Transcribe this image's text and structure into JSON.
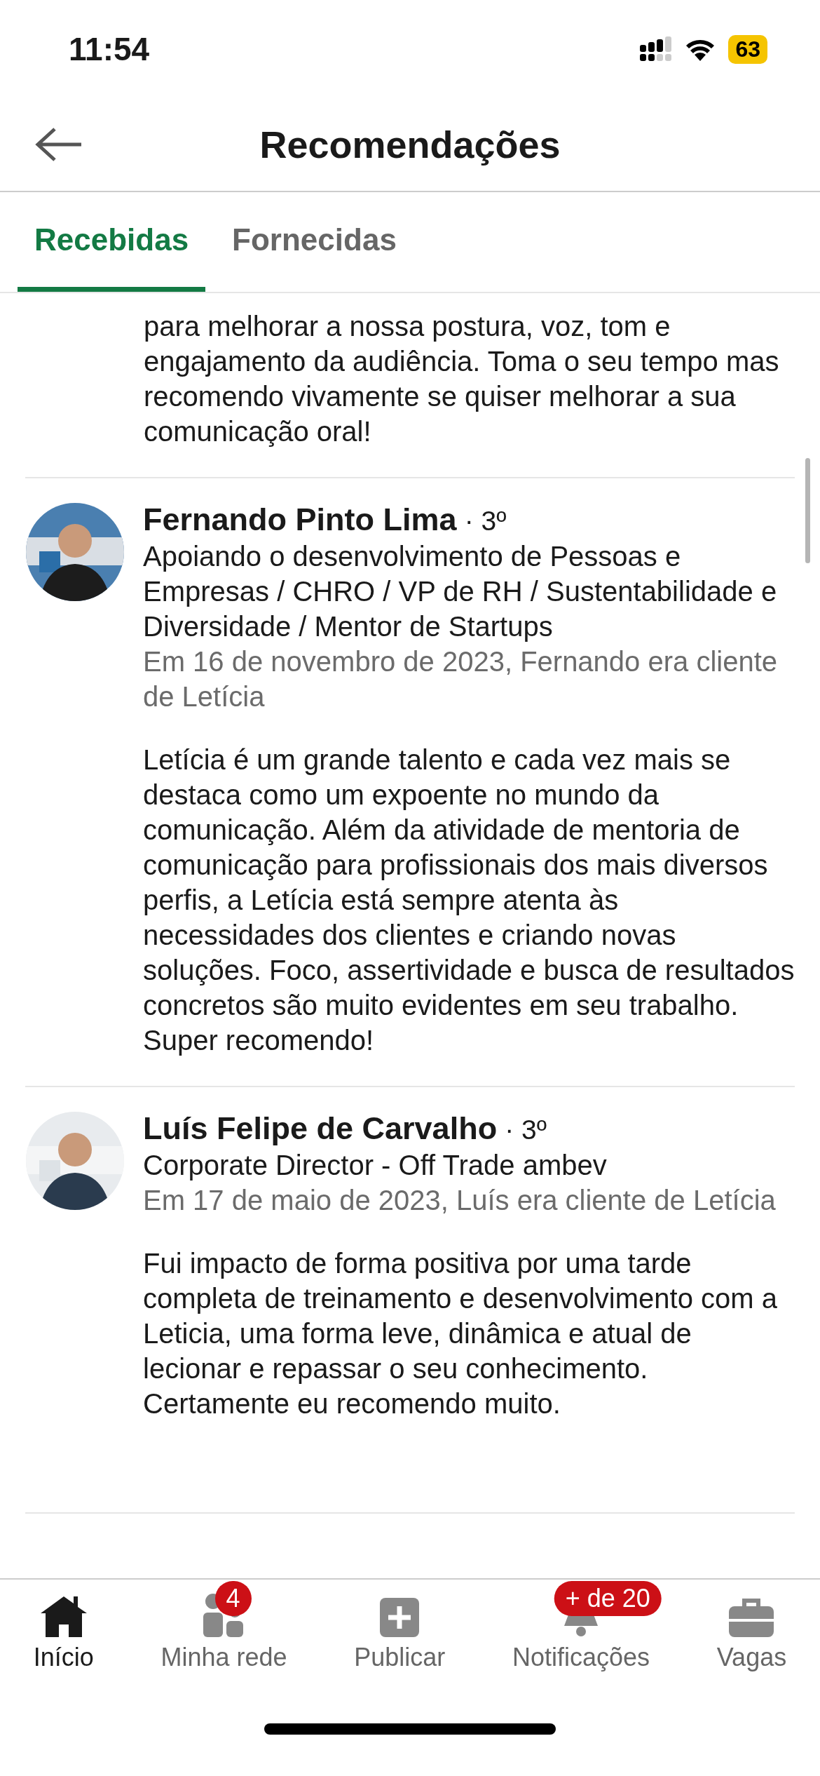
{
  "status_bar": {
    "time": "11:54",
    "battery": "63"
  },
  "header": {
    "title": "Recomendações"
  },
  "tabs": [
    {
      "label": "Recebidas",
      "selected": true
    },
    {
      "label": "Fornecidas",
      "selected": false
    }
  ],
  "recommendations": [
    {
      "kind": "continued",
      "text": "para melhorar a nossa postura, voz, tom e engajamento da audiência. Toma o seu tempo mas recomendo vivamente se quiser melhorar a sua comunicação oral!"
    },
    {
      "kind": "full",
      "name": "Fernando Pinto Lima",
      "degree": "· 3º",
      "headline": "Apoiando o desenvolvimento de Pessoas e Empresas / CHRO / VP de RH / Sustentabilidade e Diversidade / Mentor de Startups",
      "relation": "Em 16 de novembro de 2023, Fernando era cliente de Letícia",
      "text": "Letícia é um grande talento e cada vez mais se destaca como um expoente no mundo da comunicação. Além da atividade de mentoria de comunicação para profissionais dos mais diversos perfis, a Letícia está sempre atenta às necessidades dos clientes e criando novas soluções. Foco, assertividade e busca de resultados concretos são muito evidentes em seu trabalho. Super recomendo!"
    },
    {
      "kind": "full",
      "name": "Luís Felipe de Carvalho",
      "degree": "· 3º",
      "headline": "Corporate Director - Off Trade ambev",
      "relation": "Em 17 de maio de 2023, Luís era cliente de Letícia",
      "text": "Fui impacto de forma positiva por uma tarde completa de treinamento e desenvolvimento com a Leticia, uma forma leve, dinâmica e atual de lecionar e repassar o seu conhecimento. Certamente eu recomendo muito."
    }
  ],
  "nav": [
    {
      "kind": "home",
      "label": "Início",
      "selected": true
    },
    {
      "kind": "network",
      "label": "Minha rede",
      "selected": false,
      "badge": "4"
    },
    {
      "kind": "post",
      "label": "Publicar",
      "selected": false
    },
    {
      "kind": "bell",
      "label": "Notificações",
      "selected": false,
      "badge": "+ de 20"
    },
    {
      "kind": "jobs",
      "label": "Vagas",
      "selected": false
    }
  ]
}
